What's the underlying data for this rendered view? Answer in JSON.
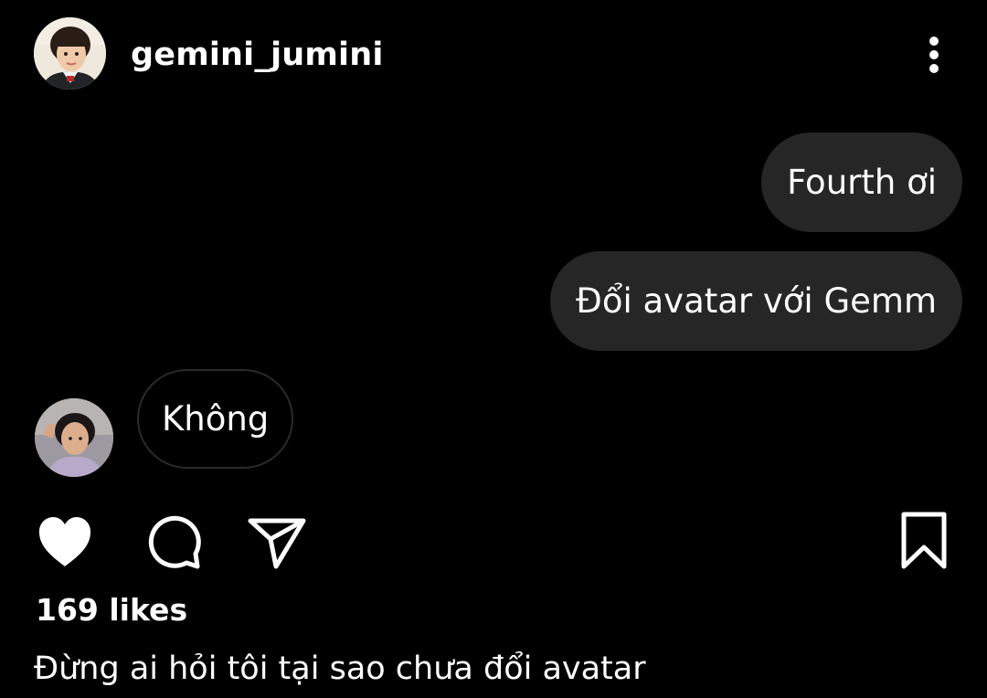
{
  "post": {
    "username": "gemini_jumini",
    "avatar_icon": "user-photo-avatar",
    "more_icon": "more-vertical-icon"
  },
  "messages": [
    {
      "direction": "outgoing",
      "text": "Fourth ơi"
    },
    {
      "direction": "outgoing",
      "text": "Đổi avatar với Gemm"
    },
    {
      "direction": "incoming",
      "text": "Không"
    }
  ],
  "actions": {
    "like_icon": "heart-filled-icon",
    "comment_icon": "comment-icon",
    "share_icon": "send-icon",
    "save_icon": "bookmark-icon"
  },
  "likes_text": "169 likes",
  "caption": "Đừng ai hỏi tôi tại sao chưa đổi avatar",
  "colors": {
    "background": "#000000",
    "bubble_outgoing": "#262626",
    "bubble_incoming_border": "#2b2b2b",
    "text": "#ffffff"
  }
}
